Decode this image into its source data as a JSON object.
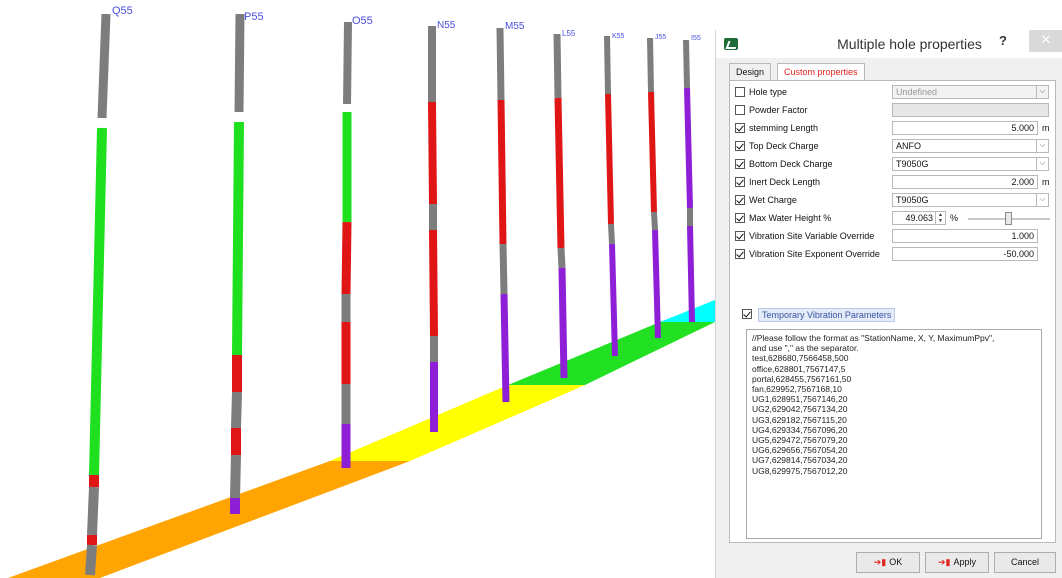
{
  "holes": [
    {
      "label": "Q55"
    },
    {
      "label": "P55"
    },
    {
      "label": "O55"
    },
    {
      "label": "N55"
    },
    {
      "label": "M55"
    },
    {
      "label": "L55"
    },
    {
      "label": "K55"
    },
    {
      "label": "J55"
    },
    {
      "label": "I55"
    }
  ],
  "scene_colors": {
    "stemming": "#7d7d7d",
    "anfo": "#1ee01e",
    "deck": "#e01616",
    "inert": "#7d7d7d",
    "t9050g": "#8e1fd6",
    "band_orange": "#ffa400",
    "band_yellow": "#ffff00",
    "band_green": "#22e022",
    "band_cyan": "#00ffff"
  },
  "dialog": {
    "title": "Multiple hole properties",
    "help": "?",
    "close": "✕",
    "tabs": [
      "Design",
      "Custom properties"
    ],
    "active_tab": "Custom properties",
    "rows": {
      "hole_type": {
        "label": "Hole type",
        "checked": false,
        "value": "Undefined"
      },
      "powder_factor": {
        "label": "Powder Factor",
        "checked": false,
        "value": ""
      },
      "stemming_length": {
        "label": "stemming Length",
        "checked": true,
        "value": "5.000",
        "unit": "m"
      },
      "top_deck": {
        "label": "Top Deck Charge",
        "checked": true,
        "value": "ANFO"
      },
      "bottom_deck": {
        "label": "Bottom Deck Charge",
        "checked": true,
        "value": "T9050G"
      },
      "inert_deck": {
        "label": "Inert Deck Length",
        "checked": true,
        "value": "2.000",
        "unit": "m"
      },
      "wet_charge": {
        "label": "Wet Charge",
        "checked": true,
        "value": "T9050G"
      },
      "max_water": {
        "label": "Max Water Height %",
        "checked": true,
        "value": "49.063",
        "unit": "%",
        "slider_fraction": 0.49
      },
      "vib_variable": {
        "label": "Vibration Site Variable Override",
        "checked": true,
        "value": "1.000"
      },
      "vib_exponent": {
        "label": "Vibration Site Exponent Override",
        "checked": true,
        "value": "-50.000"
      }
    },
    "temp_vibration": {
      "label": "Temporary Vibration Parameters",
      "checked": true,
      "text": "//Please follow the format as \"StationName, X, Y, MaximumPpv\",\nand use \",\" as the separator.\ntest,628680,7566458,500\noffice,628801,7567147,5\nportal,628455,7567161,50\nfan,629952,7567168,10\nUG1,628951,7567146,20\nUG2,629042,7567134,20\nUG3,629182,7567115,20\nUG4,629334,7567096,20\nUG5,629472,7567079,20\nUG6,629656,7567054,20\nUG7,629814,7567034,20\nUG8,629975,7567012,20"
    },
    "buttons": {
      "ok": "OK",
      "apply": "Apply",
      "cancel": "Cancel"
    }
  }
}
